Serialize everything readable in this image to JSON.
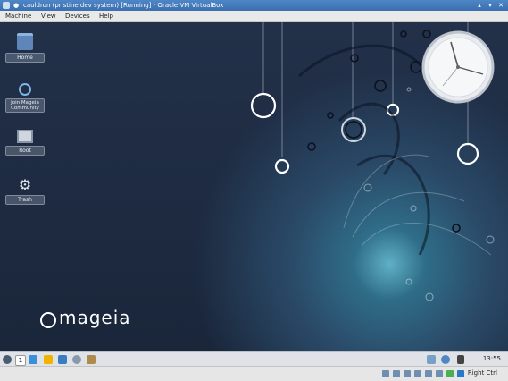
{
  "window": {
    "title": "cauldron (pristine dev system) [Running] - Oracle VM VirtualBox"
  },
  "menubar": {
    "items": [
      "Machine",
      "View",
      "Devices",
      "Help"
    ]
  },
  "desktop": {
    "icons": [
      {
        "label": "Home",
        "icon": "home-folder-icon"
      },
      {
        "label": "Join Mageia Community",
        "icon": "mageia-community-icon"
      },
      {
        "label": "Root",
        "icon": "computer-icon"
      },
      {
        "label": "Trash",
        "icon": "gear-icon"
      }
    ],
    "brand": "mageia"
  },
  "panel": {
    "workspace": "1",
    "clock": "13:55"
  },
  "vbox_status": {
    "host_key": "Right Ctrl"
  },
  "colors": {
    "titlebar": "#3a6fb0",
    "desktop_bg": "#1e2b3f",
    "glow": "#5fb0c6"
  }
}
